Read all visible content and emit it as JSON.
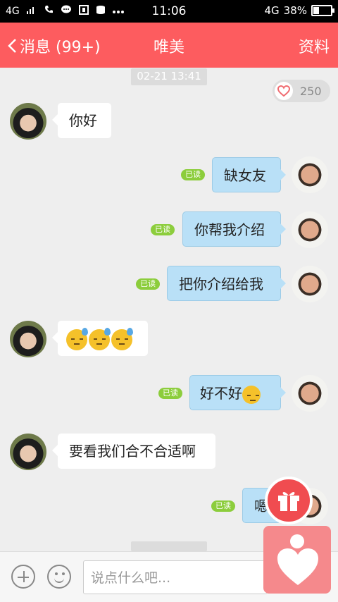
{
  "status_bar": {
    "network_left": "4G",
    "time": "11:06",
    "network_right": "4G",
    "battery": "38%",
    "battery_level": 0.38
  },
  "header": {
    "back_label": "消息 (99+)",
    "title": "唯美",
    "profile_label": "资料"
  },
  "chat": {
    "timestamp": "02-21 13:41",
    "likes": "250",
    "read_label": "已读",
    "messages": [
      {
        "sender": "other",
        "text": "你好"
      },
      {
        "sender": "me",
        "text": "缺女友",
        "read": true
      },
      {
        "sender": "me",
        "text": "你帮我介绍",
        "read": true
      },
      {
        "sender": "me",
        "text": "把你介绍给我",
        "read": true
      },
      {
        "sender": "other",
        "emojis": [
          "sweat",
          "sweat",
          "sweat"
        ]
      },
      {
        "sender": "me",
        "text": "好不好",
        "read": true,
        "emoji": "shy"
      },
      {
        "sender": "other",
        "text": "要看我们合不合适啊"
      },
      {
        "sender": "me",
        "text": "嗯",
        "read": true
      }
    ]
  },
  "input": {
    "placeholder": "说点什么吧..."
  },
  "colors": {
    "header": "#fd5c5f",
    "read_badge": "#8ccd3c",
    "out_bubble": "#b9e0f7",
    "gift": "#f04c50",
    "heart_button": "#f5898c"
  }
}
